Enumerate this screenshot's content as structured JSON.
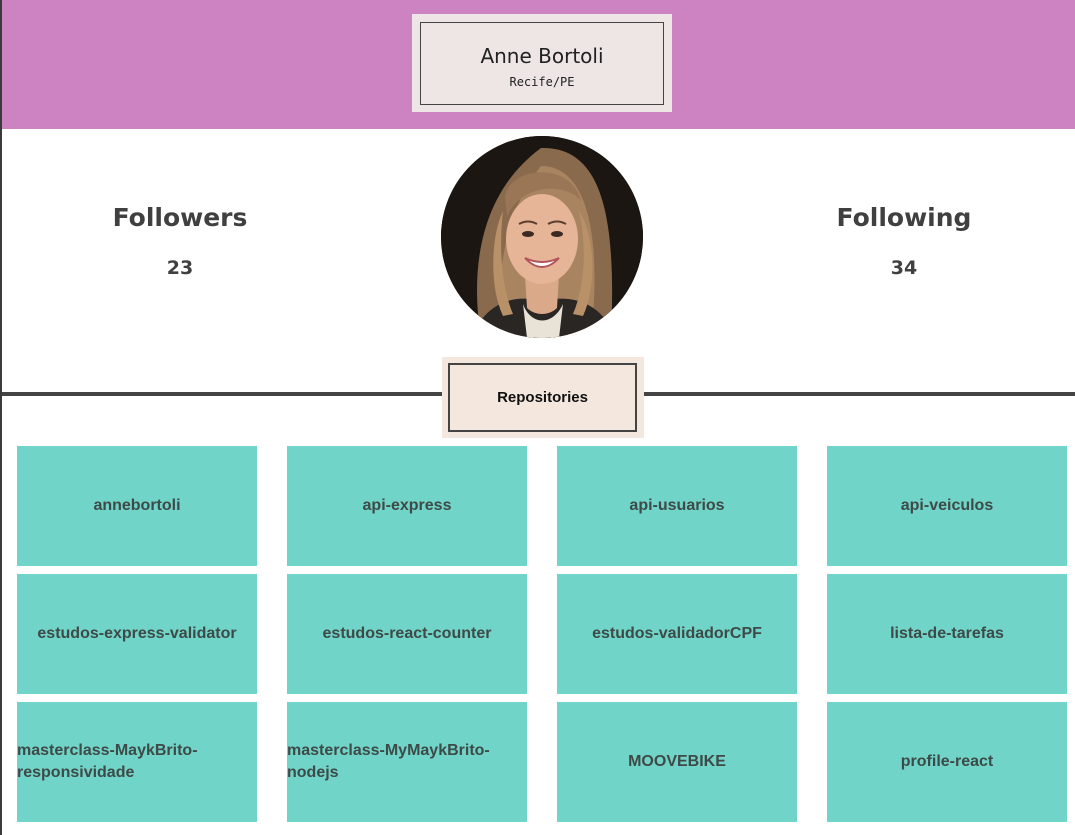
{
  "profile": {
    "name": "Anne Bortoli",
    "location": "Recife/PE"
  },
  "stats": {
    "followers_label": "Followers",
    "followers_count": "23",
    "following_label": "Following",
    "following_count": "34"
  },
  "repositories_label": "Repositories",
  "repositories": [
    {
      "name": "annebortoli"
    },
    {
      "name": "api-express"
    },
    {
      "name": "api-usuarios"
    },
    {
      "name": "api-veiculos"
    },
    {
      "name": "estudos-express-validator"
    },
    {
      "name": "estudos-react-counter"
    },
    {
      "name": "estudos-validadorCPF"
    },
    {
      "name": "lista-de-tarefas"
    },
    {
      "name": "masterclass-MaykBrito-responsividade"
    },
    {
      "name": "masterclass-MyMaykBrito-nodejs"
    },
    {
      "name": "MOOVEBIKE"
    },
    {
      "name": "profile-react"
    }
  ],
  "colors": {
    "header": "#cd82c2",
    "repo_card": "#70d4c8",
    "repo_tab": "#f4e7dd",
    "name_card": "#ede6e5"
  }
}
